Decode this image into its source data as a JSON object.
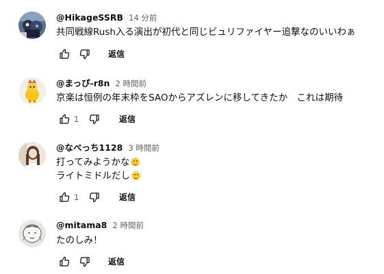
{
  "comments": [
    {
      "author": "@HikageSSRB",
      "time": "14 分前",
      "lines": [
        "共同戦線Rush入る演出が初代と同じビュリファイヤー追撃なのいいわぁ"
      ],
      "likes": "",
      "reply_label": "返信",
      "avatar_icon": "user-avatar-robot-icon"
    },
    {
      "author": "@まっぴ-r8n",
      "time": "2 時間前",
      "lines": [
        "京楽は恒例の年末枠をSAOからアズレンに移してきたか　これは期待"
      ],
      "likes": "1",
      "reply_label": "返信",
      "avatar_icon": "user-avatar-chick-icon"
    },
    {
      "author": "@なべっち1128",
      "time": "3 時間前",
      "lines": [
        "打ってみようかな",
        "ライトミドルだし"
      ],
      "likes": "1",
      "reply_label": "返信",
      "avatar_icon": "user-avatar-photo-icon"
    },
    {
      "author": "@mitama8",
      "time": "2 時間前",
      "lines": [
        "たのしみ！"
      ],
      "likes": "",
      "reply_label": "返信",
      "avatar_icon": "user-avatar-sketch-icon"
    }
  ],
  "colors": {
    "text_primary": "#0f0f0f",
    "text_secondary": "#606060",
    "background": "#ffffff"
  }
}
